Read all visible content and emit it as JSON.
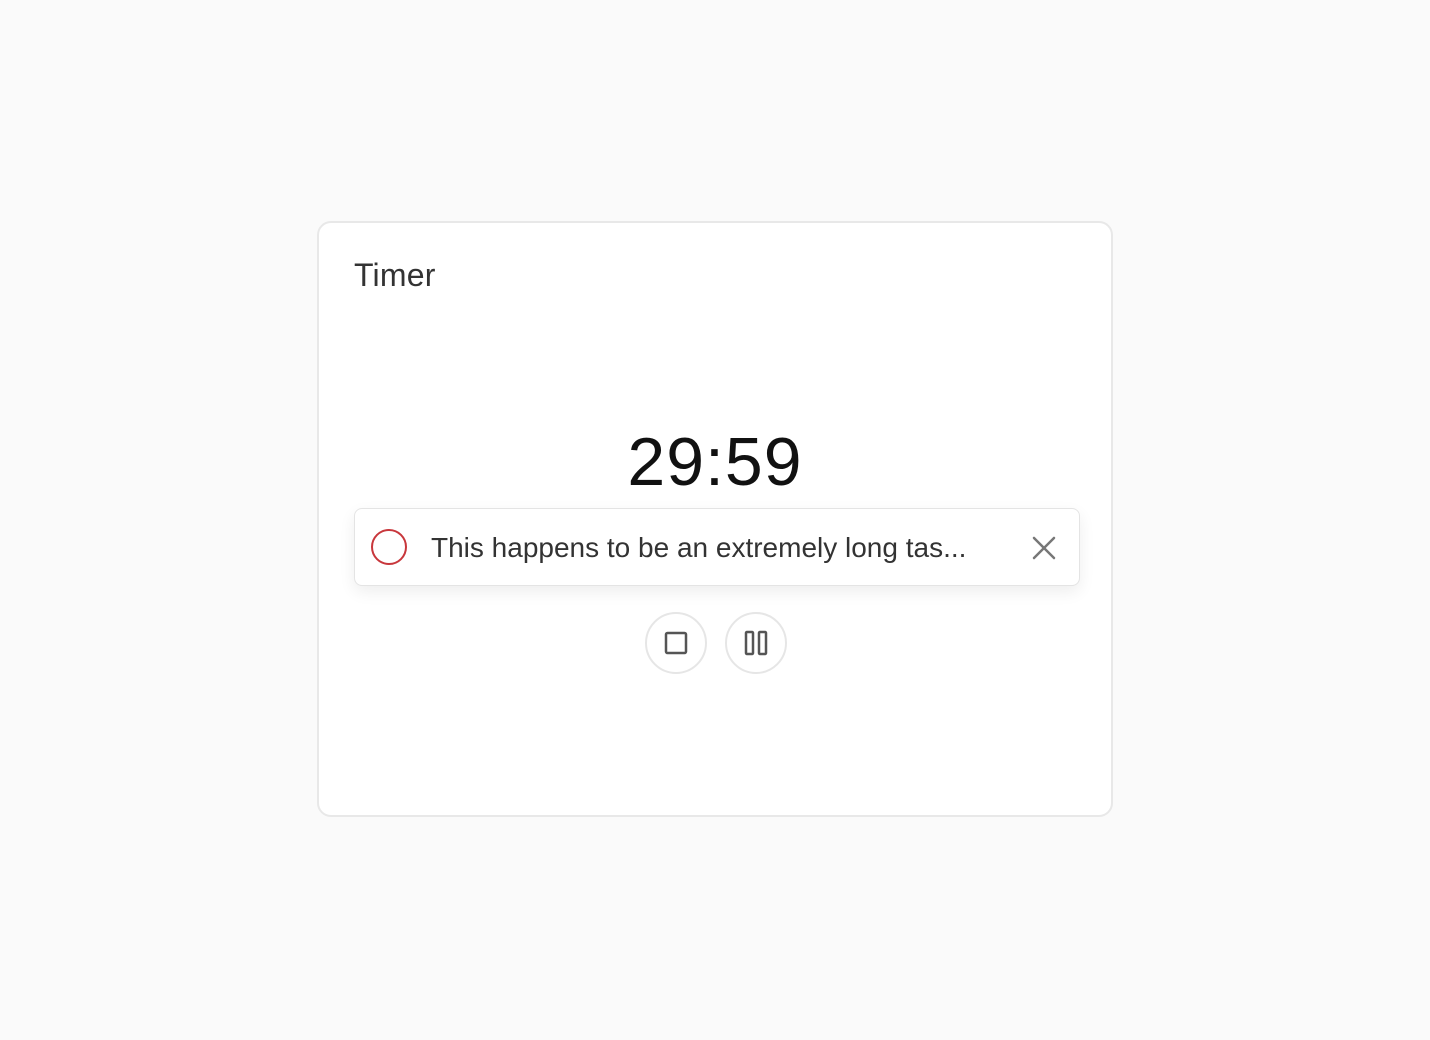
{
  "card": {
    "title": "Timer"
  },
  "timer": {
    "display": "29:59"
  },
  "task": {
    "text": "This happens to be an extremely long tas...",
    "status_icon": "circle-outline-icon",
    "status_color": "#c8373c",
    "dismiss_icon": "close-icon"
  },
  "controls": {
    "stop_icon": "stop-icon",
    "pause_icon": "pause-icon"
  }
}
